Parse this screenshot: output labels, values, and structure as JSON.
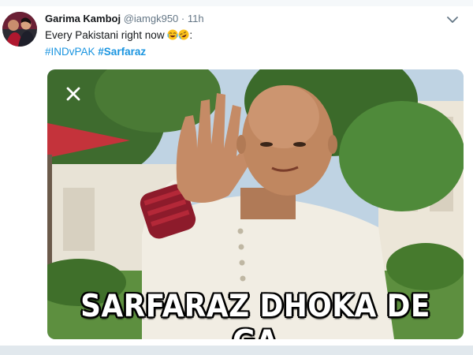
{
  "tweet": {
    "author_name": "Garima Kamboj",
    "author_handle": "@iamgk950",
    "separator": "·",
    "time": "11h",
    "text": "Every Pakistani right now",
    "emojis": [
      "face-with-tears-of-joy",
      "rolling-on-floor-laughing"
    ],
    "text_suffix": ":",
    "hashtags": [
      {
        "label": "#INDvPAK",
        "bold": false
      },
      {
        "label": "#Sarfaraz",
        "bold": true
      }
    ],
    "media": {
      "caption": "SARFARAZ DHOKA DE GA",
      "close_icon": "close-icon"
    }
  },
  "colors": {
    "hashtag": "#1b95e0",
    "handle": "#657786",
    "name": "#14171a"
  }
}
